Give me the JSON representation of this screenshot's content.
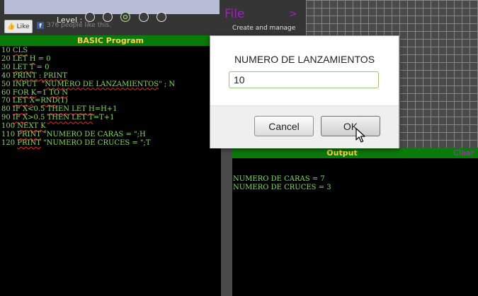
{
  "header": {
    "level_label": "Level :",
    "level_dots": 5,
    "active_level": 3,
    "like_label": "Like",
    "like_count": "376 people like this."
  },
  "file_panel": {
    "title": "File",
    "arrow": ">",
    "subtitle": "Create and manage"
  },
  "program": {
    "title": "BASIC Program",
    "lines": [
      "10 CLS",
      "20 LET H = 0",
      "30 LET T = 0",
      "40 PRINT : PRINT",
      "50 INPUT  \"NUMERO DE LANZAMIENTOS\" ; N",
      "60 FOR K=1 TO N",
      "70 LET X=RND(1)",
      "80 IF X<0.5 THEN LET H=H+1",
      "90 IF X>0.5 THEN LET T=T+1",
      "100 NEXT K",
      "110 PRINT \"NUMERO DE CARAS = \";H",
      "120 PRINT \"NUMERO DE CRUCES = \";T"
    ]
  },
  "output": {
    "title": "Output",
    "clear_label": "Clear",
    "lines": [
      "NUMERO DE CARAS = 7",
      "NUMERO DE CRUCES = 3"
    ]
  },
  "dialog": {
    "prompt": "NUMERO DE LANZAMIENTOS",
    "input_value": "10",
    "cancel_label": "Cancel",
    "ok_label": "OK"
  },
  "colors": {
    "header_green": "#0a7a0a",
    "header_text": "#ffd24a",
    "code_text": "#88d868",
    "file_purple": "#a020c0"
  }
}
